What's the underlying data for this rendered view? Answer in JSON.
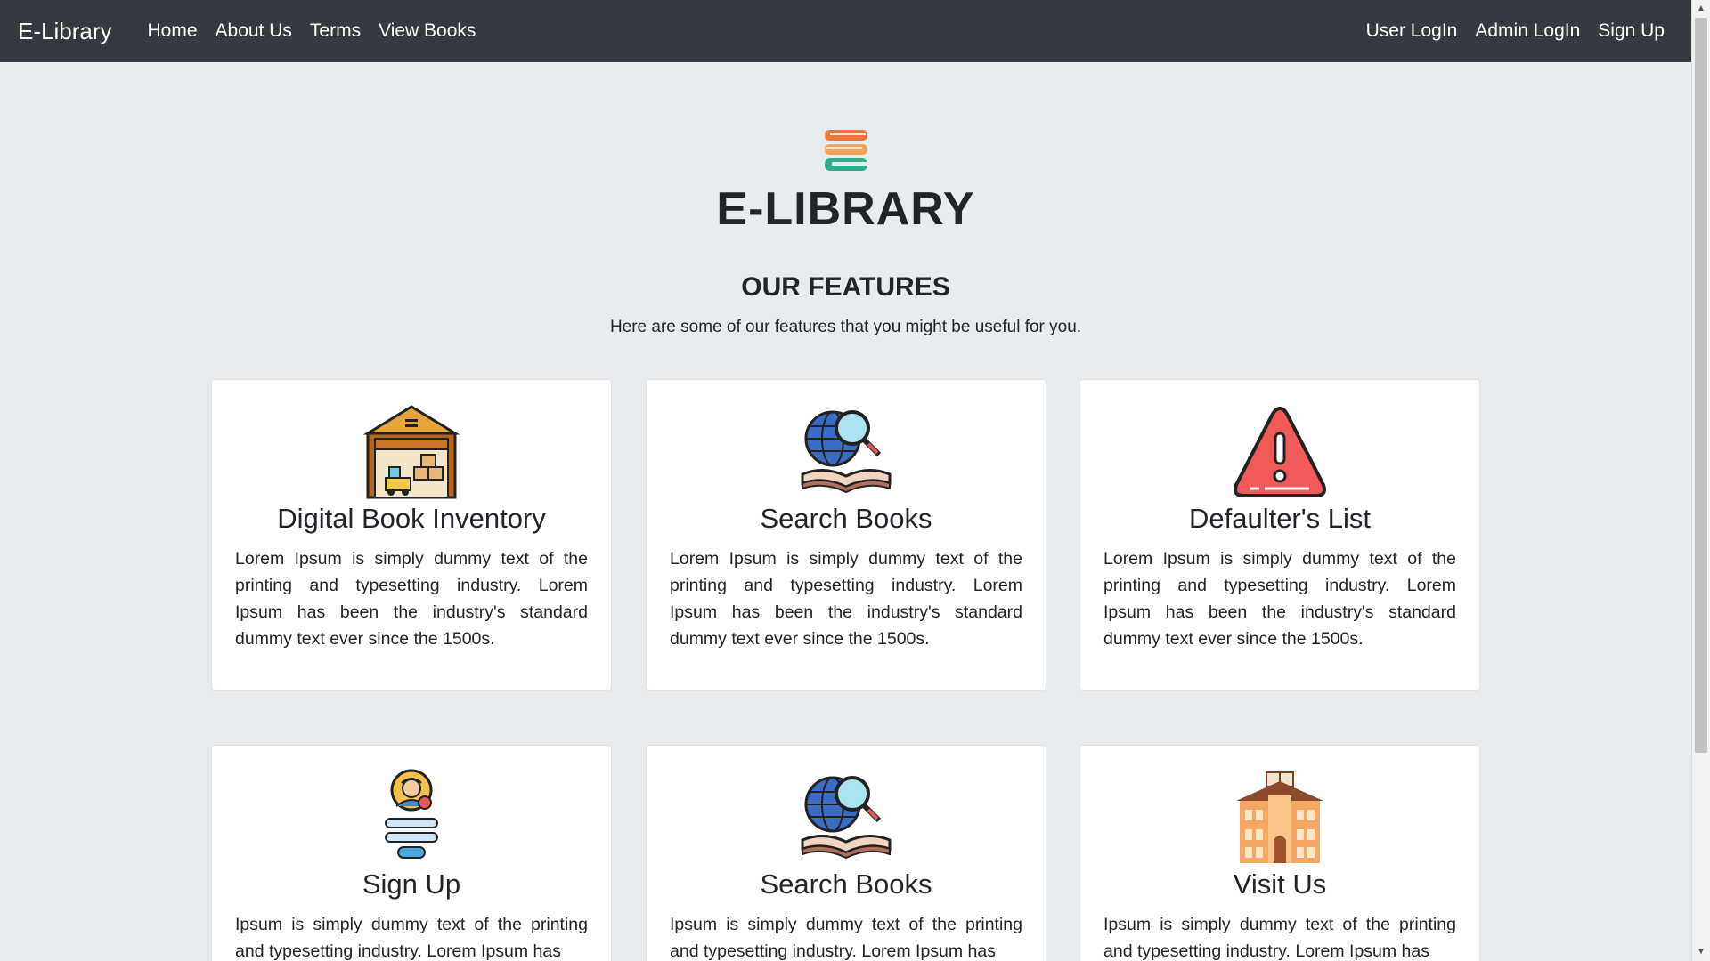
{
  "navbar": {
    "brand": "E-Library",
    "left_links": [
      "Home",
      "About Us",
      "Terms",
      "View Books"
    ],
    "right_links": [
      "User LogIn",
      "Admin LogIn",
      "Sign Up"
    ]
  },
  "hero": {
    "title": "E-LIBRARY",
    "features_heading": "OUR FEATURES",
    "features_subtitle": "Here are some of our features that you might be useful for you."
  },
  "cards": [
    {
      "title": "Digital Book Inventory",
      "text": "Lorem Ipsum is simply dummy text of the printing and typesetting industry. Lorem Ipsum has been the industry's standard dummy text ever since the 1500s.",
      "icon": "warehouse-icon"
    },
    {
      "title": "Search Books",
      "text": "Lorem Ipsum is simply dummy text of the printing and typesetting industry. Lorem Ipsum has been the industry's standard dummy text ever since the 1500s.",
      "icon": "globe-search-book-icon"
    },
    {
      "title": "Defaulter's List",
      "text": "Lorem Ipsum is simply dummy text of the printing and typesetting industry. Lorem Ipsum has been the industry's standard dummy text ever since the 1500s.",
      "icon": "warning-triangle-icon"
    },
    {
      "title": "Sign Up",
      "text": "Ipsum is simply dummy text of the printing and typesetting industry. Lorem Ipsum has",
      "icon": "user-form-icon"
    },
    {
      "title": "Search Books",
      "text": "Ipsum is simply dummy text of the printing and typesetting industry. Lorem Ipsum has",
      "icon": "globe-search-book-icon"
    },
    {
      "title": "Visit Us",
      "text": "Ipsum is simply dummy text of the printing and typesetting industry. Lorem Ipsum has",
      "icon": "library-building-icon"
    }
  ],
  "colors": {
    "navbar_bg": "#343a40",
    "page_bg": "#e9ecef",
    "card_bg": "#ffffff"
  }
}
